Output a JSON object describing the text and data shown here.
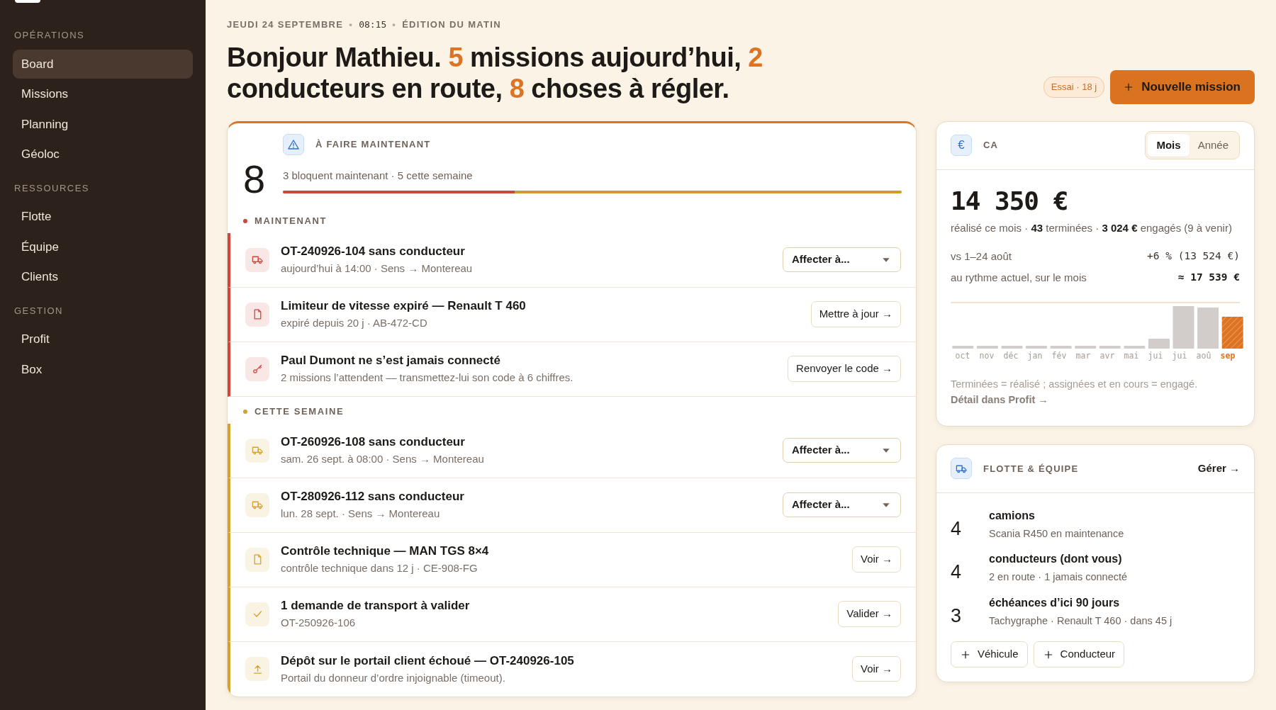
{
  "sidebar": {
    "groups": [
      {
        "label": "OPÉRATIONS",
        "items": [
          {
            "label": "Board",
            "selected": true
          },
          {
            "label": "Missions",
            "selected": false
          },
          {
            "label": "Planning",
            "selected": false
          },
          {
            "label": "Géoloc",
            "selected": false
          }
        ]
      },
      {
        "label": "RESSOURCES",
        "items": [
          {
            "label": "Flotte",
            "selected": false
          },
          {
            "label": "Équipe",
            "selected": false
          },
          {
            "label": "Clients",
            "selected": false
          }
        ]
      },
      {
        "label": "GESTION",
        "items": [
          {
            "label": "Profit",
            "selected": false
          },
          {
            "label": "Box",
            "selected": false
          }
        ]
      }
    ]
  },
  "header": {
    "date": "JEUDI 24 SEPTEMBRE",
    "separator_1": "•",
    "time": "08:15",
    "separator_2": "•",
    "edition": "ÉDITION DU MATIN",
    "headline": "Bonjour Mathieu. **5** missions aujourd’hui, **2** conducteurs en route, **8** choses à régler.",
    "trial_badge": "Essai · 18 j",
    "new_button": "Nouvelle mission"
  },
  "todo": {
    "count": "8",
    "title": "À FAIRE MAINTENANT",
    "summary": "3 bloquent maintenant · 5 cette semaine",
    "level": 0.375,
    "sections": [
      {
        "label": "MAINTENANT",
        "color": "#d2443c",
        "items": [
          {
            "kind": "truck",
            "title": "OT-240926-104 sans conducteur",
            "subtitle": "aujourd’hui à 14:00 · Sens → Montereau",
            "action": {
              "kind": "dropdown",
              "label": "Affecter à..."
            }
          },
          {
            "kind": "document",
            "title": "Limiteur de vitesse expiré — Renault T 460",
            "subtitle": "expiré depuis 20 j · AB-472-CD",
            "action": {
              "kind": "link",
              "label": "Mettre à jour →"
            }
          },
          {
            "kind": "key",
            "title": "Paul Dumont ne s’est jamais connecté",
            "subtitle": "2 missions l’attendent — transmettez-lui son code à 6 chiffres.",
            "action": {
              "kind": "link",
              "label": "Renvoyer le code →"
            }
          }
        ]
      },
      {
        "label": "CETTE SEMAINE",
        "color": "#d4a12c",
        "items": [
          {
            "kind": "truck",
            "title": "OT-260926-108 sans conducteur",
            "subtitle": "sam. 26 sept. à 08:00 · Sens → Montereau",
            "action": {
              "kind": "dropdown",
              "label": "Affecter à..."
            }
          },
          {
            "kind": "truck",
            "title": "OT-280926-112 sans conducteur",
            "subtitle": "lun. 28 sept. · Sens → Montereau",
            "action": {
              "kind": "dropdown",
              "label": "Affecter à..."
            }
          },
          {
            "kind": "document",
            "title": "Contrôle technique — MAN TGS 8×4",
            "subtitle": "contrôle technique dans 12 j · CE-908-FG",
            "action": {
              "kind": "link",
              "label": "Voir →"
            }
          },
          {
            "kind": "check",
            "title": "1 demande de transport à valider",
            "subtitle": "OT-250926-106",
            "action": {
              "kind": "link",
              "label": "Valider →"
            }
          },
          {
            "kind": "upload",
            "title": "Dépôt sur le portail client échoué — OT-240926-105",
            "subtitle": "Portail du donneur d’ordre injoignable (timeout).",
            "action": {
              "kind": "link",
              "label": "Voir →"
            }
          }
        ]
      }
    ]
  },
  "revenue": {
    "icon_glyph": "€",
    "title": "CA",
    "periods": [
      {
        "label": "Mois",
        "selected": true
      },
      {
        "label": "Année",
        "selected": false
      }
    ],
    "amount": "14 350 €",
    "summary": "réalisé ce mois · **43** terminées · **3 024 €** engagés (9 à venir)",
    "comparisons": [
      {
        "label": "vs 1–24 août",
        "value": "+6 % (13 524 €)",
        "strong": false
      },
      {
        "label": "au rythme actuel, sur le mois",
        "value": "≈ 17 539 €",
        "strong": true
      }
    ],
    "months": [
      {
        "label": "oct",
        "current": false
      },
      {
        "label": "nov",
        "current": false
      },
      {
        "label": "déc",
        "current": false
      },
      {
        "label": "jan",
        "current": false
      },
      {
        "label": "fév",
        "current": false
      },
      {
        "label": "mar",
        "current": false
      },
      {
        "label": "avr",
        "current": false
      },
      {
        "label": "mai",
        "current": false
      },
      {
        "label": "jui",
        "current": false
      },
      {
        "label": "jui",
        "current": false
      },
      {
        "label": "aoû",
        "current": false
      },
      {
        "label": "sep",
        "current": true
      }
    ],
    "note": "Terminées = réalisé ; assignées et en cours = engagé.",
    "note_link": "Détail dans Profit →"
  },
  "fleet": {
    "title": "FLOTTE & ÉQUIPE",
    "manage": "Gérer →",
    "stats": [
      {
        "count": "4",
        "title": "camions",
        "subtitle": "Scania R450 en maintenance"
      },
      {
        "count": "4",
        "title": "conducteurs (dont vous)",
        "subtitle": "2 en route · 1 jamais connecté"
      },
      {
        "count": "3",
        "title": "échéances d’ici 90 jours",
        "subtitle": "Tachygraphe · Renault T 460 · dans 45 j"
      }
    ],
    "buttons": [
      "Véhicule",
      "Conducteur"
    ]
  }
}
